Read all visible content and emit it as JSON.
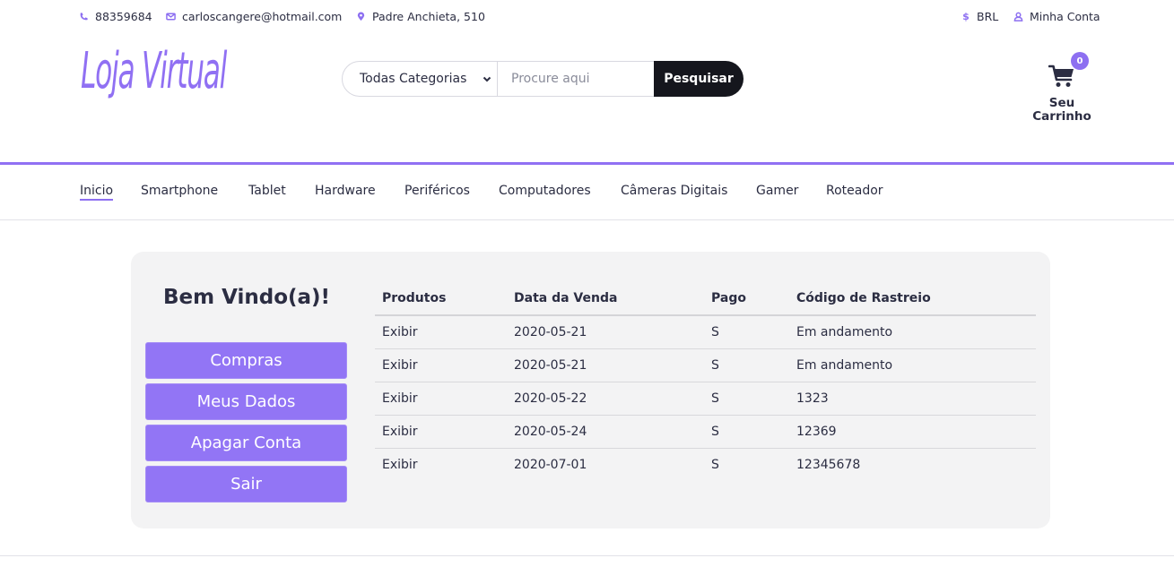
{
  "topbar": {
    "phone": "88359684",
    "email": "carloscangere@hotmail.com",
    "address": "Padre Anchieta, 510",
    "currency": "BRL",
    "account": "Minha Conta"
  },
  "header": {
    "logo": "Loja Virtual",
    "search": {
      "category_selected": "Todas Categorias",
      "placeholder": "Procure aqui",
      "button": "Pesquisar"
    },
    "cart": {
      "count": "0",
      "label": "Seu Carrinho"
    }
  },
  "nav": {
    "items": [
      {
        "label": "Inicio"
      },
      {
        "label": "Smartphone"
      },
      {
        "label": "Tablet"
      },
      {
        "label": "Hardware"
      },
      {
        "label": "Periféricos"
      },
      {
        "label": "Computadores"
      },
      {
        "label": "Câmeras Digitais"
      },
      {
        "label": "Gamer"
      },
      {
        "label": "Roteador"
      }
    ]
  },
  "account": {
    "welcome": "Bem Vindo(a)!",
    "menu": [
      {
        "label": "Compras"
      },
      {
        "label": "Meus Dados"
      },
      {
        "label": "Apagar Conta"
      },
      {
        "label": "Sair"
      }
    ]
  },
  "orders": {
    "columns": [
      "Produtos",
      "Data da Venda",
      "Pago",
      "Código de Rastreio"
    ],
    "rows": [
      [
        "Exibir",
        "2020-05-21",
        "S",
        "Em andamento"
      ],
      [
        "Exibir",
        "2020-05-21",
        "S",
        "Em andamento"
      ],
      [
        "Exibir",
        "2020-05-22",
        "S",
        "1323"
      ],
      [
        "Exibir",
        "2020-05-24",
        "S",
        "12369"
      ],
      [
        "Exibir",
        "2020-07-01",
        "S",
        "12345678"
      ]
    ]
  },
  "colors": {
    "accent": "#8d6ff1",
    "button_dark": "#15161d",
    "text": "#2b2d42"
  }
}
